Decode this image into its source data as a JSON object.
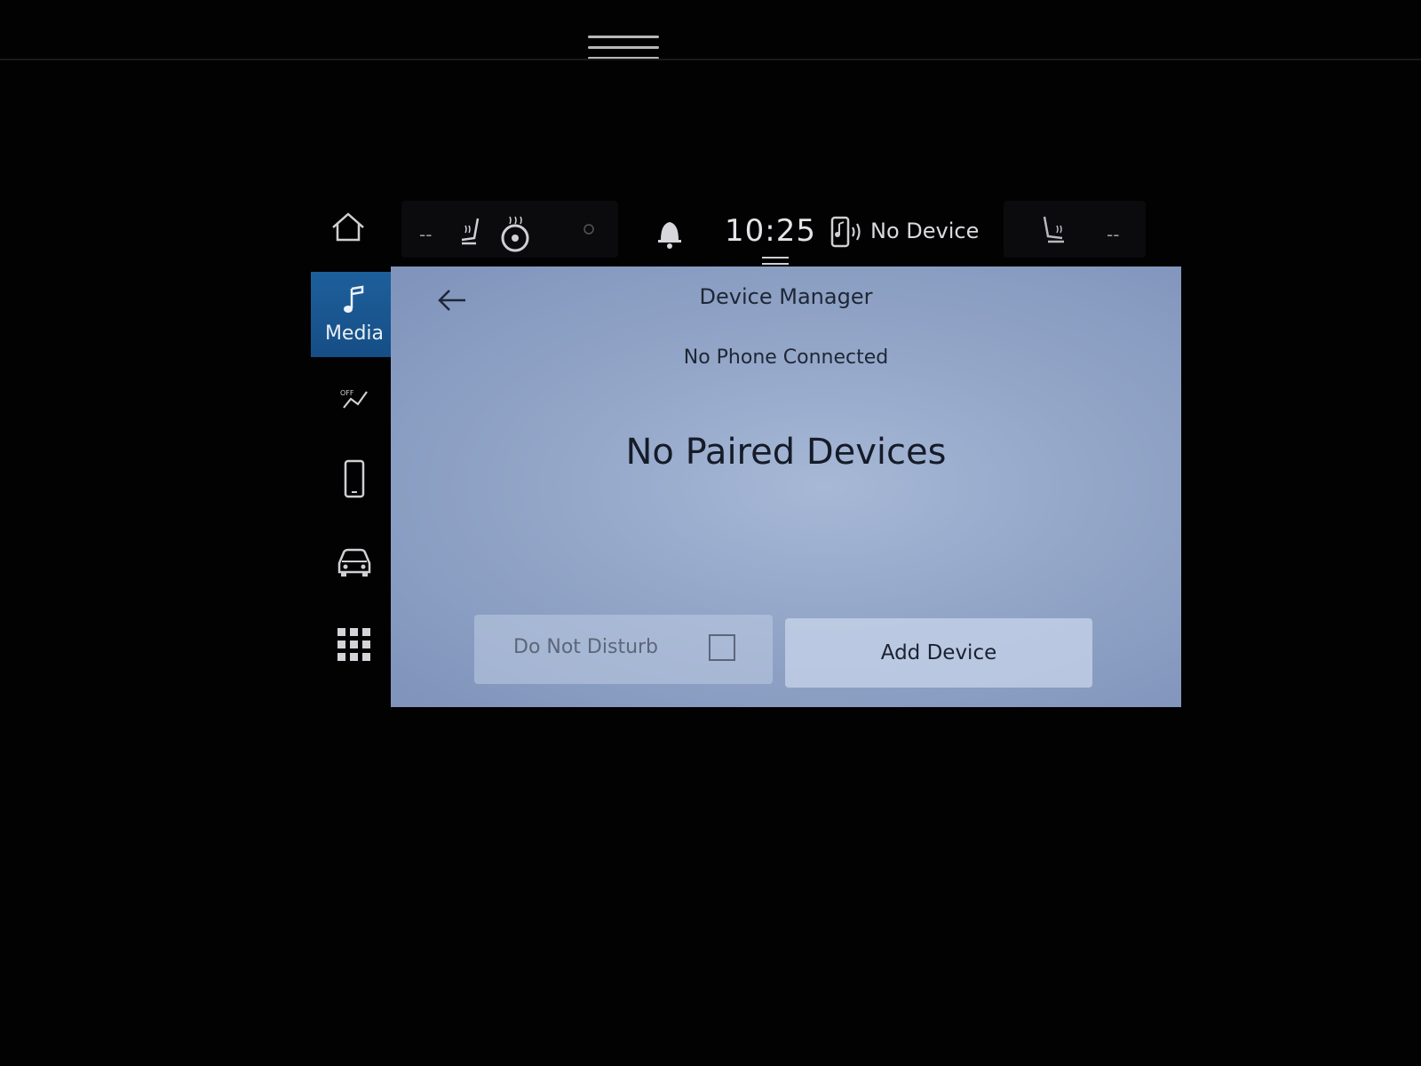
{
  "status_bar": {
    "left_temp": "--",
    "right_temp": "--",
    "time": "10:25",
    "device": "No Device"
  },
  "sidebar": {
    "items": [
      {
        "label": "Media",
        "icon": "music-note-icon",
        "active": true
      },
      {
        "label": "",
        "icon": "fan-off-icon"
      },
      {
        "label": "",
        "icon": "phone-icon"
      },
      {
        "label": "",
        "icon": "car-icon"
      },
      {
        "label": "",
        "icon": "apps-grid-icon"
      }
    ]
  },
  "panel": {
    "title": "Device Manager",
    "status": "No Phone Connected",
    "message": "No Paired Devices",
    "dnd_label": "Do Not Disturb",
    "add_label": "Add Device"
  },
  "colors": {
    "accent": "#1d5f9b",
    "panel_bg": "#93a6c8",
    "background": "#020203"
  }
}
